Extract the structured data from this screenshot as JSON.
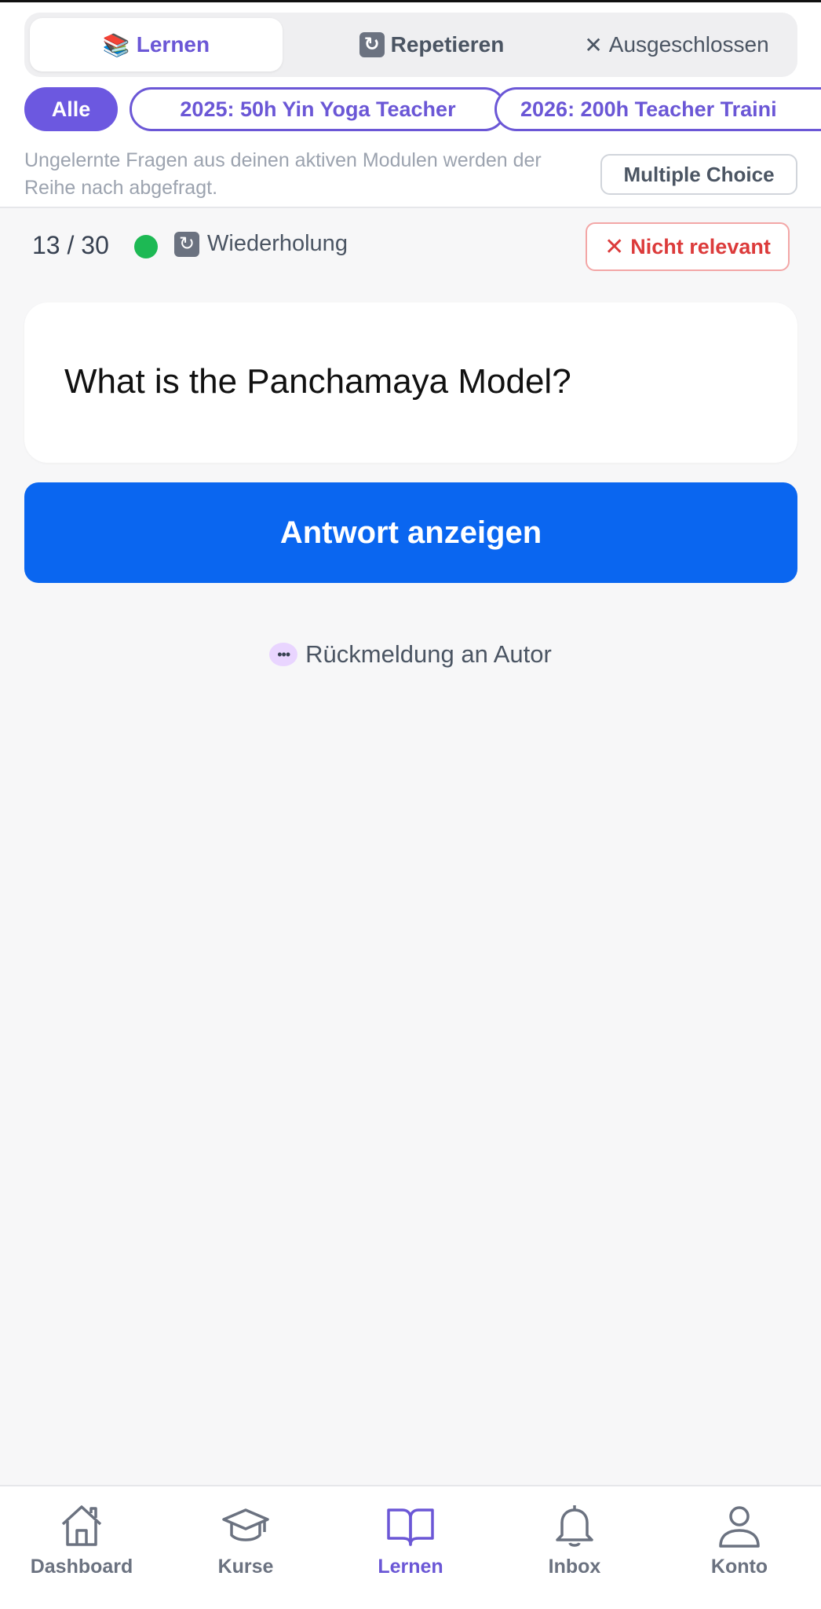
{
  "tabs": [
    {
      "icon": "📚",
      "label": "Lernen",
      "active": true
    },
    {
      "icon": "🔄",
      "label": "Repetieren",
      "active": false
    },
    {
      "icon": "✕",
      "label": "Ausgeschlossen",
      "active": false
    }
  ],
  "filters": [
    {
      "label": "Alle",
      "active": true
    },
    {
      "label": "2025: 50h Yin Yoga Teacher",
      "active": false
    },
    {
      "label": "2026: 200h Teacher Traini",
      "active": false
    }
  ],
  "hint_text": "Ungelernte Fragen aus deinen aktiven Modulen werden der Reihe nach abgefragt.",
  "mode_button": "Multiple Choice",
  "status": {
    "counter": "13 / 30",
    "type_label": "Wiederholung",
    "dot_color": "#1db954",
    "not_relevant_label": "Nicht relevant"
  },
  "question": "What is the Panchamaya Model?",
  "show_answer_label": "Antwort anzeigen",
  "feedback_label": "Rückmeldung an Autor",
  "nav": [
    {
      "label": "Dashboard",
      "icon": "home-icon",
      "active": false
    },
    {
      "label": "Kurse",
      "icon": "graduation-cap-icon",
      "active": false
    },
    {
      "label": "Lernen",
      "icon": "book-icon",
      "active": true
    },
    {
      "label": "Inbox",
      "icon": "bell-icon",
      "active": false
    },
    {
      "label": "Konto",
      "icon": "user-icon",
      "active": false
    }
  ],
  "colors": {
    "accent": "#6b57d6",
    "primary_button": "#0a66f0",
    "danger": "#dc3b3b"
  }
}
